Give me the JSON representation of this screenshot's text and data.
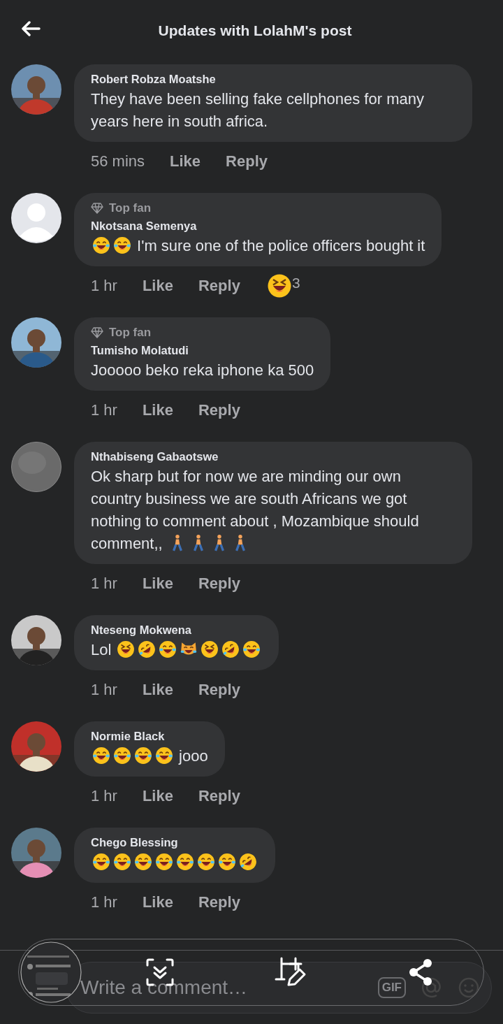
{
  "header": {
    "title": "Updates with LolahM's post"
  },
  "comments": [
    {
      "name": "Robert Robza Moatshe",
      "body": [
        {
          "kind": "text",
          "text": "They have been selling fake cellphones for many years here in south africa."
        }
      ],
      "time": "56 mins",
      "like": "Like",
      "reply": "Reply"
    },
    {
      "avatar": {
        "kind": "default"
      },
      "badge": "Top fan",
      "name": "Nkotsana Semenya",
      "body": [
        {
          "kind": "tears-of-joy"
        },
        {
          "kind": "tears-of-joy"
        },
        {
          "kind": "text",
          "text": "I'm sure one of the police officers bought it"
        }
      ],
      "time": "1 hr",
      "like": "Like",
      "reply": "Reply",
      "reaction": {
        "kind": "squint-laugh",
        "count": "3"
      }
    },
    {
      "badge": "Top fan",
      "name": "Tumisho Molatudi",
      "body": [
        {
          "kind": "text",
          "text": "Jooooo beko reka iphone ka 500"
        }
      ],
      "time": "1 hr",
      "like": "Like",
      "reply": "Reply"
    },
    {
      "avatar": {
        "kind": "blur"
      },
      "name": "Nthabiseng Gabaotswe",
      "body": [
        {
          "kind": "text",
          "text": "Ok sharp but for now we are minding our own country business we are south Africans we got nothing to comment about , Mozambique should comment,,"
        },
        {
          "kind": "walking"
        },
        {
          "kind": "walking"
        },
        {
          "kind": "walking"
        },
        {
          "kind": "walking"
        }
      ],
      "time": "1 hr",
      "like": "Like",
      "reply": "Reply"
    },
    {
      "name": "Nteseng Mokwena",
      "body": [
        {
          "kind": "text",
          "text": "Lol"
        },
        {
          "kind": "squint-laugh"
        },
        {
          "kind": "rolling-laugh"
        },
        {
          "kind": "tears-of-joy"
        },
        {
          "kind": "cat-laugh"
        },
        {
          "kind": "squint-laugh"
        },
        {
          "kind": "rolling-laugh"
        },
        {
          "kind": "tears-of-joy"
        }
      ],
      "time": "1 hr",
      "like": "Like",
      "reply": "Reply"
    },
    {
      "name": "Normie Black",
      "body": [
        {
          "kind": "tears-of-joy"
        },
        {
          "kind": "tears-of-joy"
        },
        {
          "kind": "tears-of-joy"
        },
        {
          "kind": "tears-of-joy"
        },
        {
          "kind": "text",
          "text": "jooo"
        }
      ],
      "time": "1 hr",
      "like": "Like",
      "reply": "Reply"
    },
    {
      "name": "Chego Blessing",
      "body": [
        {
          "kind": "tears-of-joy"
        },
        {
          "kind": "tears-of-joy"
        },
        {
          "kind": "tears-of-joy"
        },
        {
          "kind": "tears-of-joy"
        },
        {
          "kind": "tears-of-joy"
        },
        {
          "kind": "tears-of-joy"
        },
        {
          "kind": "tears-of-joy"
        },
        {
          "kind": "rolling-laugh"
        }
      ],
      "time": "1 hr",
      "like": "Like",
      "reply": "Reply"
    }
  ],
  "composer": {
    "placeholder": "Write a comment…",
    "gif": "GIF"
  }
}
